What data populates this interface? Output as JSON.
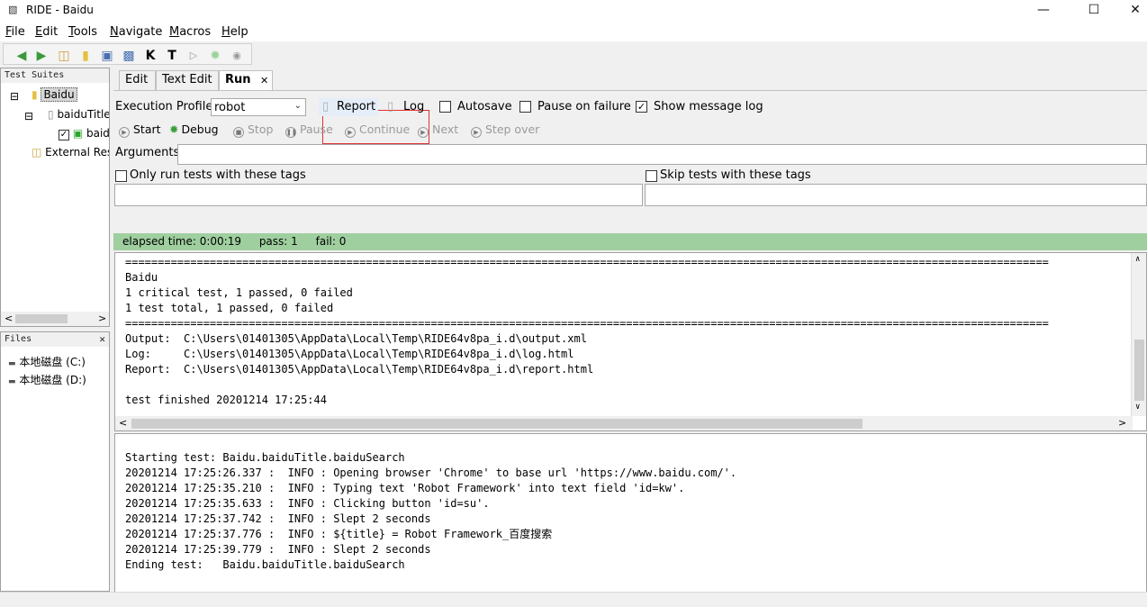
{
  "window": {
    "title": "RIDE - Baidu"
  },
  "menu": [
    {
      "label": "File",
      "key": "F",
      "rest": "ile"
    },
    {
      "label": "Edit",
      "key": "E",
      "rest": "dit"
    },
    {
      "label": "Tools",
      "key": "T",
      "rest": "ools"
    },
    {
      "label": "Navigate",
      "key": "N",
      "rest": "avigate"
    },
    {
      "label": "Macros",
      "key": "M",
      "rest": "acros"
    },
    {
      "label": "Help",
      "key": "H",
      "rest": "elp"
    }
  ],
  "toolbar": {
    "icons": [
      "back-arrow-icon",
      "forward-arrow-icon",
      "open-folder-icon",
      "new-file-icon",
      "save-icon",
      "save-all-icon",
      "keyword-search-icon",
      "test-search-icon",
      "run-icon",
      "debug-icon",
      "stop-icon"
    ],
    "k_label": "K",
    "t_label": "T"
  },
  "tree": {
    "header": "Test Suites",
    "items": [
      {
        "label": "Baidu"
      },
      {
        "label": "baiduTitle"
      },
      {
        "label": "baiduSearch"
      },
      {
        "label": "External Resources"
      }
    ]
  },
  "files": {
    "header": "Files",
    "close": "✕",
    "drives": [
      "本地磁盘 (C:)",
      "本地磁盘 (D:)"
    ]
  },
  "tabs": [
    {
      "label": "Edit"
    },
    {
      "label": "Text Edit"
    },
    {
      "label": "Run"
    }
  ],
  "tab_close": "✕",
  "run": {
    "profile_label": "Execution Profile:",
    "profile_value": "robot",
    "report_label": "Report",
    "log_label": "Log",
    "autosave_label": "Autosave",
    "autosave_checked": false,
    "pause_label": "Pause on failure",
    "pause_checked": false,
    "show_log_label": "Show message log",
    "show_log_checked": true,
    "buttons": {
      "start": "Start",
      "debug": "Debug",
      "stop": "Stop",
      "pause": "Pause",
      "continue": "Continue",
      "next": "Next",
      "step_over": "Step over"
    },
    "arguments_label": "Arguments:",
    "arguments_value": "",
    "only_tags_label": "Only run tests with these tags",
    "skip_tags_label": "Skip tests with these tags"
  },
  "status": {
    "elapsed": "elapsed time: 0:00:19",
    "pass": "pass: 1",
    "fail": "fail: 0",
    "color": "#9fcf9f"
  },
  "console_output": [
    "==============================================================================================================================================",
    "Baidu",
    "1 critical test, 1 passed, 0 failed",
    "1 test total, 1 passed, 0 failed",
    "==============================================================================================================================================",
    "Output:  C:\\Users\\01401305\\AppData\\Local\\Temp\\RIDE64v8pa_i.d\\output.xml",
    "Log:     C:\\Users\\01401305\\AppData\\Local\\Temp\\RIDE64v8pa_i.d\\log.html",
    "Report:  C:\\Users\\01401305\\AppData\\Local\\Temp\\RIDE64v8pa_i.d\\report.html",
    "",
    "test finished 20201214 17:25:44"
  ],
  "message_log": [
    "",
    "Starting test: Baidu.baiduTitle.baiduSearch",
    "20201214 17:25:26.337 :  INFO : Opening browser 'Chrome' to base url 'https://www.baidu.com/'.",
    "20201214 17:25:35.210 :  INFO : Typing text 'Robot Framework' into text field 'id=kw'.",
    "20201214 17:25:35.633 :  INFO : Clicking button 'id=su'.",
    "20201214 17:25:37.742 :  INFO : Slept 2 seconds",
    "20201214 17:25:37.776 :  INFO : ${title} = Robot Framework_百度搜索",
    "20201214 17:25:39.779 :  INFO : Slept 2 seconds",
    "Ending test:   Baidu.baiduTitle.baiduSearch"
  ]
}
